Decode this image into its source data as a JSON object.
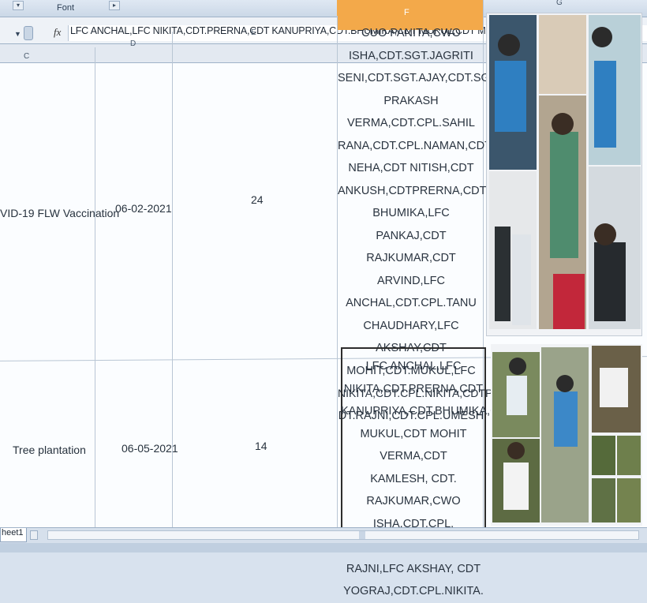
{
  "ribbon": {
    "group_label": "Font"
  },
  "formula_bar": {
    "fx": "fx",
    "content": "LFC ANCHAL,LFC NIKITA,CDT.PRERNA,CDT KANUPRIYA,CDT.BHUMIKA,CDT MUKUL,CDT MOHIT VE"
  },
  "columns": {
    "c": "C",
    "d": "D",
    "e": "E",
    "f": "F",
    "g": "G"
  },
  "rows": [
    {
      "activity": "VID-19 FLW Vaccination",
      "date": "06-02-2021",
      "count": "24",
      "names": [
        "CUO PANITA,CWO",
        "ISHA,CDT.SGT.JAGRITI",
        "SENI,CDT.SGT.AJAY,CDT.SGT.JAI",
        "PRAKASH VERMA,CDT.CPL.SAHIL",
        "RANA,CDT.CPL.NAMAN,CDT",
        "NEHA,CDT NITISH,CDT",
        "ANKUSH,CDTPRERNA,CDT",
        "BHUMIKA,LFC PANKAJ,CDT",
        "RAJKUMAR,CDT ARVIND,LFC",
        "ANCHAL,CDT.CPL.TANU",
        "CHAUDHARY,LFC AKSHAY,CDT",
        "MOHIT,CDT.MUKUL,LFC",
        "NIKITA,CDT.CPL.NIKITA,CDTPUNEET,C",
        "DT.RAJNI,CDT.CPL.UMESH"
      ]
    },
    {
      "activity": "Tree plantation",
      "date": "06-05-2021",
      "count": "14",
      "names": [
        "LFC ANCHAL,LFC",
        "NIKITA,CDT.PRERNA,CDT",
        "KANUPRIYA,CDT.BHUMIKA,CDT",
        "MUKUL,CDT MOHIT VERMA,CDT",
        "KAMLESH, CDT. RAJKUMAR,CWO",
        "ISHA,CDT.CPL. NAMAN,CDT",
        "RAJNI,LFC AKSHAY, CDT",
        "YOGRAJ,CDT.CPL.NIKITA."
      ]
    }
  ],
  "sheet": {
    "tab_label": "heet1"
  },
  "colors": {
    "column_f_header": "#f3a94a",
    "grid": "#fbfdff",
    "chrome": "#d8e2ee"
  }
}
